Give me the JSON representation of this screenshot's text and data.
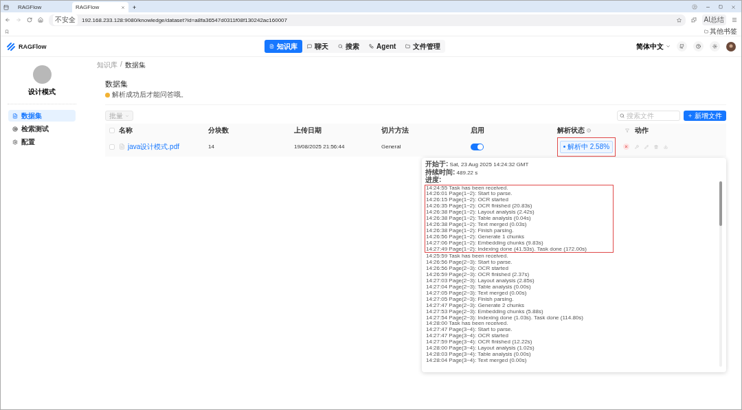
{
  "browser": {
    "tabs": [
      {
        "title": "RAGFlow",
        "selected": false
      },
      {
        "title": "RAGFlow",
        "selected": true
      }
    ],
    "new_tab": "+",
    "security": "不安全",
    "url": "192.168.233.128:9080/knowledge/dataset?id=a8fa36547d0311f08f130242ac160007",
    "ai_button": "AI总结",
    "bookmark_folder": "其他书签"
  },
  "app": {
    "logo": "RAGFlow",
    "nav": [
      {
        "label": "知识库",
        "selected": true,
        "kind": "dataset"
      },
      {
        "label": "聊天",
        "selected": false,
        "kind": "chat"
      },
      {
        "label": "搜索",
        "selected": false,
        "kind": "search"
      },
      {
        "label": "Agent",
        "selected": false,
        "kind": "agent"
      },
      {
        "label": "文件管理",
        "selected": false,
        "kind": "folder"
      }
    ],
    "language": "简体中文"
  },
  "breadcrumb": {
    "items": [
      "知识库",
      "数据集"
    ],
    "separator": "/"
  },
  "sidebar": {
    "name": "设计模式",
    "items": [
      {
        "label": "数据集",
        "selected": true,
        "kind": "dataset"
      },
      {
        "label": "检索测试",
        "selected": false,
        "kind": "retrieval"
      },
      {
        "label": "配置",
        "selected": false,
        "kind": "settings"
      }
    ]
  },
  "page": {
    "title": "数据集",
    "hint": "解析成功后才能问答哦。",
    "bulk_button": "批量",
    "search": {
      "placeholder": "搜索文件"
    },
    "add_button": "新增文件"
  },
  "table": {
    "select_all": {
      "checked": false
    },
    "columns": [
      "名称",
      "分块数",
      "上传日期",
      "切片方法",
      "启用",
      "解析状态",
      "动作"
    ],
    "rows": [
      {
        "checked": false,
        "name": "java设计模式.pdf",
        "chunks": "14",
        "date": "19/08/2025 21:56:44",
        "method": "General",
        "enabled": true,
        "status": {
          "label": "解析中",
          "progress": "2.58%",
          "highlighted": true
        }
      }
    ]
  },
  "popup": {
    "fields": [
      {
        "label": "开始于:",
        "value": "Sat, 23 Aug 2025 14:24:32 GMT"
      },
      {
        "label": "持续时间:",
        "value": "489.22 s"
      }
    ],
    "progress_label": "进度:",
    "log_groups": [
      {
        "highlighted": true,
        "lines": [
          "14:24:55 Task has been received.",
          "14:26:01 Page(1~2): Start to parse.",
          "14:26:15 Page(1~2): OCR started",
          "14:26:35 Page(1~2): OCR finished (20.83s)",
          "14:26:38 Page(1~2): Layout analysis (2.42s)",
          "14:26:38 Page(1~2): Table analysis (0.04s)",
          "14:26:38 Page(1~2): Text merged (0.03s)",
          "14:26:38 Page(1~2): Finish parsing.",
          "14:26:56 Page(1~2): Generate 1 chunks",
          "14:27:06 Page(1~2): Embedding chunks (9.83s)",
          "14:27:49 Page(1~2): Indexing done (41.53s). Task done (172.00s)"
        ]
      },
      {
        "highlighted": false,
        "lines": [
          "14:25:59 Task has been received.",
          "14:26:56 Page(2~3): Start to parse.",
          "14:26:56 Page(2~3): OCR started",
          "14:26:59 Page(2~3): OCR finished (2.37s)",
          "14:27:03 Page(2~3): Layout analysis (2.85s)",
          "14:27:04 Page(2~3): Table analysis (0.00s)",
          "14:27:05 Page(2~3): Text merged (0.00s)",
          "14:27:05 Page(2~3): Finish parsing.",
          "14:27:47 Page(2~3): Generate 2 chunks",
          "14:27:53 Page(2~3): Embedding chunks (5.88s)",
          "14:27:54 Page(2~3): Indexing done (1.03s). Task done (114.80s)",
          "14:28:00 Task has been received.",
          "14:27:47 Page(3~4): Start to parse.",
          "14:27:47 Page(3~4): OCR started",
          "14:27:59 Page(3~4): OCR finished (12.22s)",
          "14:28:00 Page(3~4): Layout analysis (1.02s)",
          "14:28:03 Page(3~4): Table analysis (0.00s)",
          "14:28:04 Page(3~4): Text merged (0.00s)"
        ]
      }
    ]
  }
}
